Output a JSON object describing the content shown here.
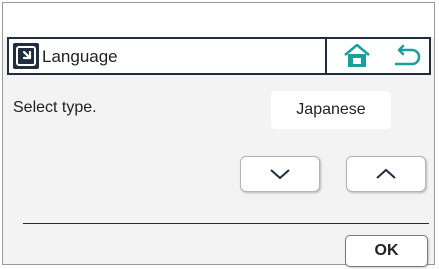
{
  "header": {
    "title": "Language",
    "title_icon": "settings-panel-icon",
    "home_icon": "home-icon",
    "back_icon": "back-arrow-icon"
  },
  "main": {
    "select_label": "Select type.",
    "selected_value": "Japanese",
    "down_icon": "chevron-down-icon",
    "up_icon": "chevron-up-icon"
  },
  "footer": {
    "ok_label": "OK"
  },
  "colors": {
    "accent": "#1a9e9e",
    "border_dark": "#1f2d3d",
    "panel_bg": "#f3f3f3"
  }
}
